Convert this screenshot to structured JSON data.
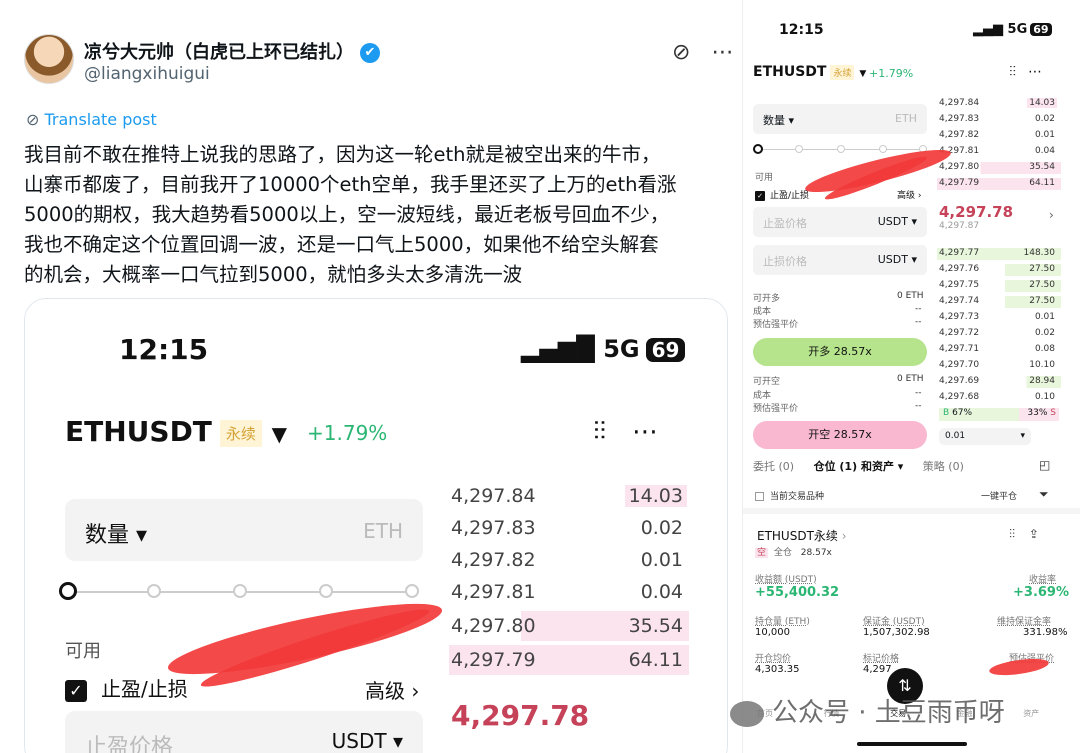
{
  "tweet": {
    "name": "凉兮大元帅（白虎已上环已结扎）",
    "verified_icon": "✔",
    "handle": "@liangxihuigui",
    "translate_label": "Translate post",
    "text_lines": [
      "我目前不敢在推特上说我的思路了，因为这一轮eth就是被空出来的牛市，",
      "山寨币都废了，目前我开了10000个eth空单，我手里还买了上万的eth看涨",
      "5000的期权，我大趋势看5000以上，空一波短线，最近老板号回血不少，",
      "我也不确定这个位置回调一波，还是一口气上5000，如果他不给空头解套",
      "的机会，大概率一口气拉到5000，就怕多头太多清洗一波"
    ]
  },
  "zoomed": {
    "time": "12:15",
    "network": "5G",
    "battery": "69",
    "pair": "ETHUSDT",
    "perp_tag": "永续",
    "change": "+1.79%",
    "quantity_label": "数量 ▾",
    "quantity_unit": "ETH",
    "available_label": "可用",
    "tpsl_label": "止盈/止损",
    "advanced_label": "高级 ›",
    "tp_price_label": "止盈价格",
    "tp_unit": "USDT ▾",
    "last_price": "4,297.78",
    "orderbook": [
      {
        "price": "4,297.84",
        "qty": "14.03"
      },
      {
        "price": "4,297.83",
        "qty": "0.02"
      },
      {
        "price": "4,297.82",
        "qty": "0.01"
      },
      {
        "price": "4,297.81",
        "qty": "0.04"
      },
      {
        "price": "4,297.80",
        "qty": "35.54"
      },
      {
        "price": "4,297.79",
        "qty": "64.11"
      }
    ]
  },
  "phone": {
    "time": "12:15",
    "network": "5G",
    "battery": "69",
    "pair": "ETHUSDT",
    "perp_tag": "永续",
    "change": "+1.79%",
    "quantity_label": "数量 ▾",
    "quantity_unit": "ETH",
    "available_label": "可用",
    "tpsl_label": "止盈/止损",
    "advanced_label": "高级 ›",
    "tp_label": "止盈价格",
    "sl_label": "止损价格",
    "unit": "USDT ▾",
    "open_long_label": "可开多",
    "open_long_value": "0 ETH",
    "cost_label": "成本",
    "cost_value": "--",
    "liq_label": "预估强平价",
    "liq_value": "--",
    "long_button": "开多 28.57x",
    "open_short_label": "可开空",
    "open_short_value": "0 ETH",
    "cost2_value": "--",
    "liq2_value": "--",
    "short_button": "开空 28.57x",
    "last_price": "4,297.78",
    "mark_price": "4,297.87",
    "asks": [
      {
        "price": "4,297.84",
        "qty": "14.03"
      },
      {
        "price": "4,297.83",
        "qty": "0.02"
      },
      {
        "price": "4,297.82",
        "qty": "0.01"
      },
      {
        "price": "4,297.81",
        "qty": "0.04"
      },
      {
        "price": "4,297.80",
        "qty": "35.54"
      },
      {
        "price": "4,297.79",
        "qty": "64.11"
      }
    ],
    "bids": [
      {
        "price": "4,297.77",
        "qty": "148.30"
      },
      {
        "price": "4,297.76",
        "qty": "27.50"
      },
      {
        "price": "4,297.75",
        "qty": "27.50"
      },
      {
        "price": "4,297.74",
        "qty": "27.50"
      },
      {
        "price": "4,297.73",
        "qty": "0.01"
      },
      {
        "price": "4,297.72",
        "qty": "0.02"
      },
      {
        "price": "4,297.71",
        "qty": "0.08"
      },
      {
        "price": "4,297.70",
        "qty": "10.10"
      },
      {
        "price": "4,297.69",
        "qty": "28.94"
      },
      {
        "price": "4,297.68",
        "qty": "0.10"
      }
    ],
    "buy_ratio": "67%",
    "sell_ratio": "33%",
    "depth": "0.01",
    "tabs": [
      "委托 (0)",
      "仓位 (1) 和资产 ▾",
      "策略 (0)"
    ],
    "current_only": "当前交易品种",
    "close_all": "一键平仓",
    "position": {
      "title": "ETHUSDT永续",
      "side": "空",
      "mode": "全仓",
      "leverage": "28.57x",
      "pnl_label": "收益额 (USDT)",
      "pnl": "+55,400.32",
      "roe_label": "收益率",
      "roe": "+3.69%",
      "size_label": "持仓量 (ETH)",
      "size": "10,000",
      "margin_label": "保证金 (USDT)",
      "margin": "1,507,302.98",
      "mmr_label": "维持保证金率",
      "mmr": "331.98%",
      "entry_label": "开仓均价",
      "entry": "4,303.35",
      "mark_label": "标记价格",
      "mark": "4,297",
      "liq_label": "预估强平价"
    },
    "nav": [
      "首页",
      "行情",
      "交易",
      "金融",
      "资产"
    ]
  },
  "watermark": "公众号 · 土豆雨币呀",
  "colors": {
    "up": "#2bb673",
    "down": "#c54259",
    "ask_bg": "#fce4ee",
    "bid_bg": "#e8f6dc"
  }
}
